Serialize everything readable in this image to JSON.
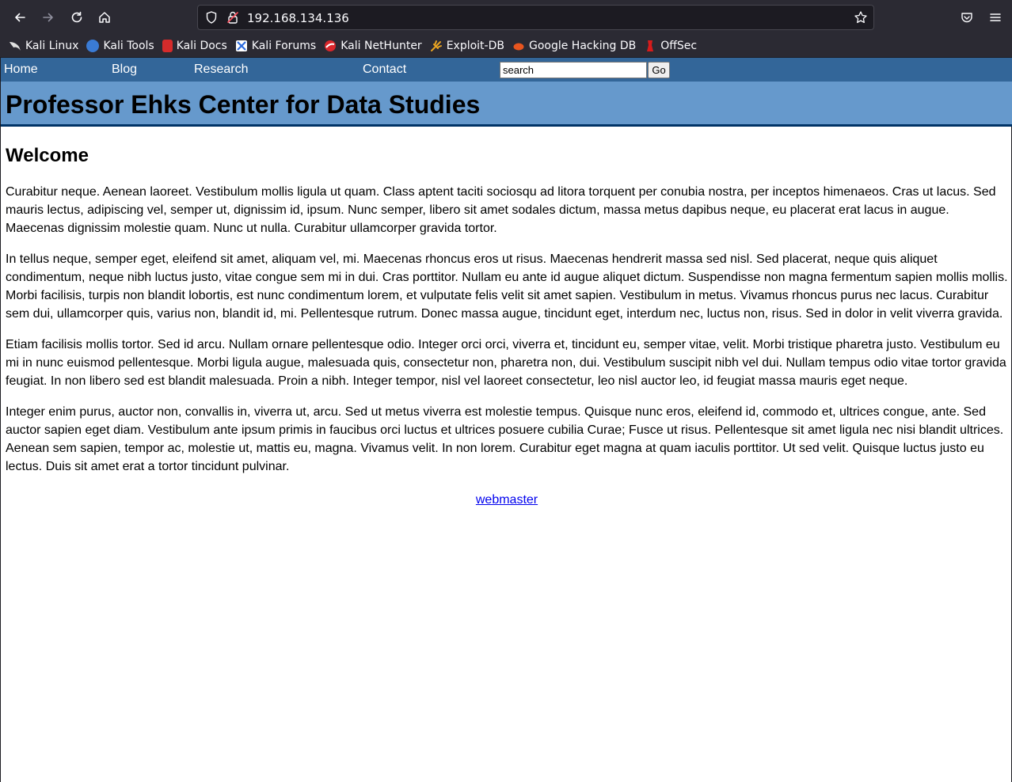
{
  "browser": {
    "url": "192.168.134.136",
    "bookmarks": [
      {
        "label": "Kali Linux",
        "icon": "kali-dragon-icon",
        "color": "#e0e0e0"
      },
      {
        "label": "Kali Tools",
        "icon": "kali-tools-icon",
        "color": "#3a7bd5"
      },
      {
        "label": "Kali Docs",
        "icon": "kali-docs-icon",
        "color": "#d52b2b"
      },
      {
        "label": "Kali Forums",
        "icon": "kali-forums-icon",
        "color": "#2d6cdf"
      },
      {
        "label": "Kali NetHunter",
        "icon": "nethunter-icon",
        "color": "#d9262b"
      },
      {
        "label": "Exploit-DB",
        "icon": "exploit-db-icon",
        "color": "#e8a322"
      },
      {
        "label": "Google Hacking DB",
        "icon": "ghdb-icon",
        "color": "#e8551f"
      },
      {
        "label": "OffSec",
        "icon": "offsec-icon",
        "color": "#d71b1b"
      }
    ]
  },
  "site": {
    "nav": {
      "home": "Home",
      "blog": "Blog",
      "research": "Research",
      "contact": "Contact",
      "search_value": "search",
      "go_label": "Go"
    },
    "banner_title": "Professor Ehks Center for Data Studies",
    "heading": "Welcome",
    "paragraphs": [
      "Curabitur neque. Aenean laoreet. Vestibulum mollis ligula ut quam. Class aptent taciti sociosqu ad litora torquent per conubia nostra, per inceptos himenaeos. Cras ut lacus. Sed mauris lectus, adipiscing vel, semper ut, dignissim id, ipsum. Nunc semper, libero sit amet sodales dictum, massa metus dapibus neque, eu placerat erat lacus in augue. Maecenas dignissim molestie quam. Nunc ut nulla. Curabitur ullamcorper gravida tortor.",
      "In tellus neque, semper eget, eleifend sit amet, aliquam vel, mi. Maecenas rhoncus eros ut risus. Maecenas hendrerit massa sed nisl. Sed placerat, neque quis aliquet condimentum, neque nibh luctus justo, vitae congue sem mi in dui. Cras porttitor. Nullam eu ante id augue aliquet dictum. Suspendisse non magna fermentum sapien mollis mollis. Morbi facilisis, turpis non blandit lobortis, est nunc condimentum lorem, et vulputate felis velit sit amet sapien. Vestibulum in metus. Vivamus rhoncus purus nec lacus. Curabitur sem dui, ullamcorper quis, varius non, blandit id, mi. Pellentesque rutrum. Donec massa augue, tincidunt eget, interdum nec, luctus non, risus. Sed in dolor in velit viverra gravida.",
      "Etiam facilisis mollis tortor. Sed id arcu. Nullam ornare pellentesque odio. Integer orci orci, viverra et, tincidunt eu, semper vitae, velit. Morbi tristique pharetra justo. Vestibulum eu mi in nunc euismod pellentesque. Morbi ligula augue, malesuada quis, consectetur non, pharetra non, dui. Vestibulum suscipit nibh vel dui. Nullam tempus odio vitae tortor gravida feugiat. In non libero sed est blandit malesuada. Proin a nibh. Integer tempor, nisl vel laoreet consectetur, leo nisl auctor leo, id feugiat massa mauris eget neque.",
      "Integer enim purus, auctor non, convallis in, viverra ut, arcu. Sed ut metus viverra est molestie tempus. Quisque nunc eros, eleifend id, commodo et, ultrices congue, ante. Sed auctor sapien eget diam. Vestibulum ante ipsum primis in faucibus orci luctus et ultrices posuere cubilia Curae; Fusce ut risus. Pellentesque sit amet ligula nec nisi blandit ultrices. Aenean sem sapien, tempor ac, molestie ut, mattis eu, magna. Vivamus velit. In non lorem. Curabitur eget magna at quam iaculis porttitor. Ut sed velit. Quisque luctus justo eu lectus. Duis sit amet erat a tortor tincidunt pulvinar."
    ],
    "footer_link": "webmaster"
  },
  "colors": {
    "nav_bar": "#336699",
    "banner": "#6699cc",
    "banner_border": "#003366",
    "chrome_bg": "#2b2a33",
    "link": "#0000ee"
  }
}
